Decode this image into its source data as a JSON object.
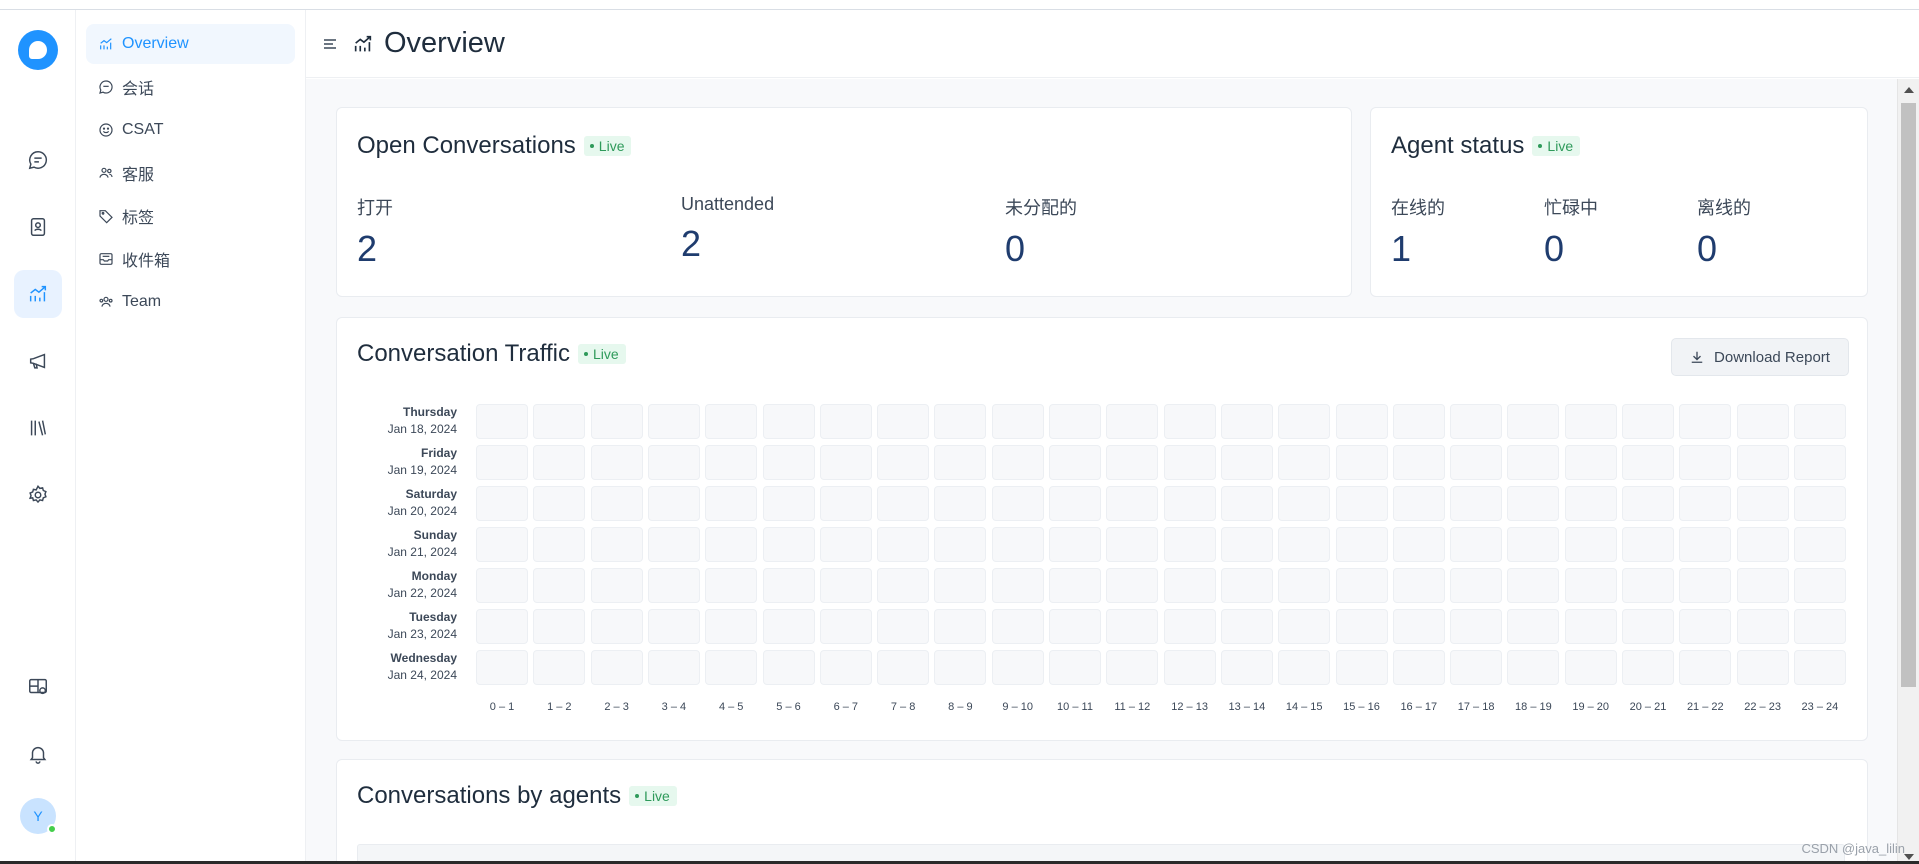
{
  "header": {
    "title": "Overview"
  },
  "sidebar": {
    "items": [
      {
        "label": "Overview",
        "icon": "chart-line-icon",
        "active": true
      },
      {
        "label": "会话",
        "icon": "chat-bubble-icon"
      },
      {
        "label": "CSAT",
        "icon": "smiley-icon"
      },
      {
        "label": "客服",
        "icon": "people-icon"
      },
      {
        "label": "标签",
        "icon": "tag-icon"
      },
      {
        "label": "收件箱",
        "icon": "inbox-icon"
      },
      {
        "label": "Team",
        "icon": "team-icon"
      }
    ]
  },
  "rail": {
    "items": [
      "chat-icon",
      "contacts-icon",
      "reports-icon",
      "megaphone-icon",
      "library-icon",
      "settings-icon",
      "dashboard-apps-icon",
      "bell-icon"
    ],
    "avatar_initial": "Y"
  },
  "open_conversations": {
    "title": "Open Conversations",
    "live": "Live",
    "metrics": [
      {
        "label": "打开",
        "value": "2"
      },
      {
        "label": "Unattended",
        "value": "2"
      },
      {
        "label": "未分配的",
        "value": "0"
      }
    ]
  },
  "agent_status": {
    "title": "Agent status",
    "live": "Live",
    "metrics": [
      {
        "label": "在线的",
        "value": "1"
      },
      {
        "label": "忙碌中",
        "value": "0"
      },
      {
        "label": "离线的",
        "value": "0"
      }
    ]
  },
  "traffic": {
    "title": "Conversation Traffic",
    "live": "Live",
    "download_label": "Download Report",
    "days": [
      {
        "day": "Thursday",
        "date": "Jan 18, 2024"
      },
      {
        "day": "Friday",
        "date": "Jan 19, 2024"
      },
      {
        "day": "Saturday",
        "date": "Jan 20, 2024"
      },
      {
        "day": "Sunday",
        "date": "Jan 21, 2024"
      },
      {
        "day": "Monday",
        "date": "Jan 22, 2024"
      },
      {
        "day": "Tuesday",
        "date": "Jan 23, 2024"
      },
      {
        "day": "Wednesday",
        "date": "Jan 24, 2024"
      }
    ],
    "hours": [
      "0 – 1",
      "1 – 2",
      "2 – 3",
      "3 – 4",
      "4 – 5",
      "5 – 6",
      "6 – 7",
      "7 – 8",
      "8 – 9",
      "9 – 10",
      "10 – 11",
      "11 – 12",
      "12 – 13",
      "13 – 14",
      "14 – 15",
      "15 – 16",
      "16 – 17",
      "17 – 18",
      "18 – 19",
      "19 – 20",
      "20 – 21",
      "21 – 22",
      "22 – 23",
      "23 – 24"
    ]
  },
  "agents_card": {
    "title": "Conversations by agents",
    "live": "Live"
  },
  "watermark": "CSDN @java_lilin",
  "colors": {
    "accent": "#1f93ff",
    "live_bg": "#e6f8ee",
    "live_text": "#2e9a5a",
    "metric_value": "#1f3c6e"
  }
}
